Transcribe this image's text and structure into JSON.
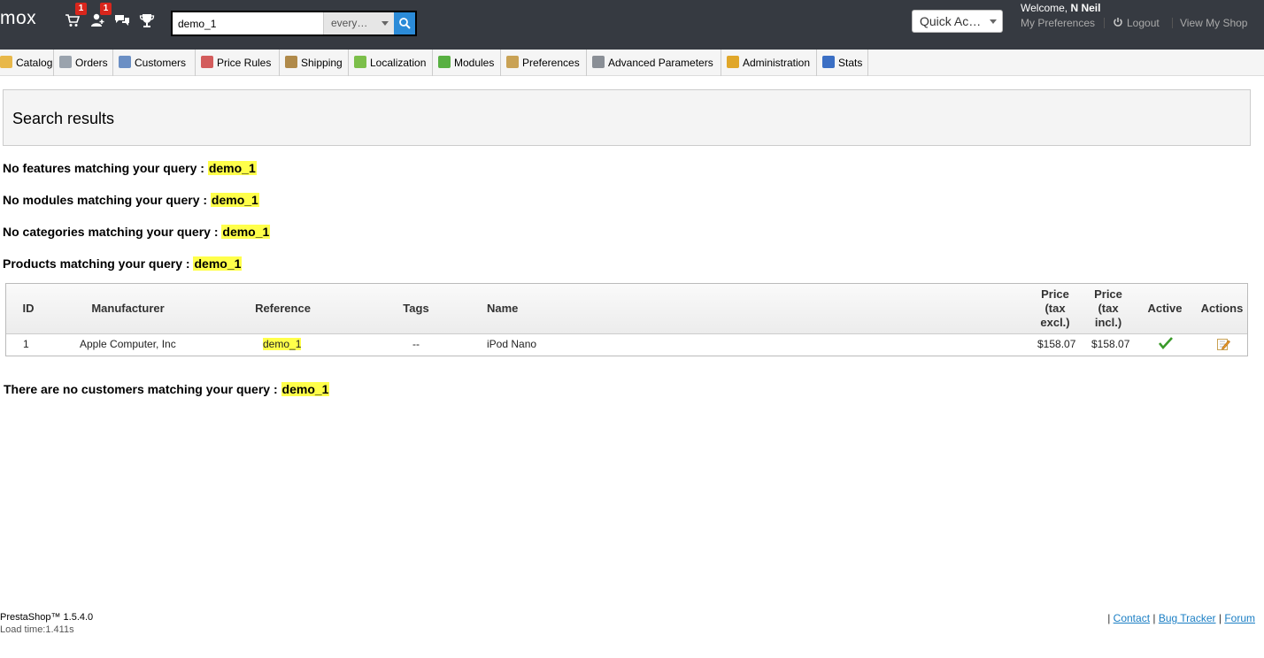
{
  "header": {
    "shop_name": "mox",
    "notifications": {
      "orders_badge": "1",
      "customers_badge": "1"
    },
    "search": {
      "value": "demo_1",
      "scope": "every…"
    },
    "quick_access": "Quick Ac…",
    "welcome_prefix": "Welcome, ",
    "user_name": "N Neil",
    "my_preferences": "My Preferences",
    "logout": "Logout",
    "view_shop": "View My Shop"
  },
  "menu": {
    "items": [
      {
        "label": "Catalog",
        "icon": "folder-icon",
        "color": "#e8b84a"
      },
      {
        "label": "Orders",
        "icon": "cart-icon",
        "color": "#9aa3ad"
      },
      {
        "label": "Customers",
        "icon": "user-icon",
        "color": "#6b8fc4"
      },
      {
        "label": "Price Rules",
        "icon": "tag-icon",
        "color": "#d35c5c"
      },
      {
        "label": "Shipping",
        "icon": "truck-icon",
        "color": "#b08a4a"
      },
      {
        "label": "Localization",
        "icon": "globe-icon",
        "color": "#7cbf4a"
      },
      {
        "label": "Modules",
        "icon": "puzzle-icon",
        "color": "#58b042"
      },
      {
        "label": "Preferences",
        "icon": "settings-icon",
        "color": "#c9a255"
      },
      {
        "label": "Advanced Parameters",
        "icon": "wrench-icon",
        "color": "#8a8f96"
      },
      {
        "label": "Administration",
        "icon": "key-icon",
        "color": "#e0a72a"
      },
      {
        "label": "Stats",
        "icon": "chart-icon",
        "color": "#3b6fc4"
      }
    ]
  },
  "page": {
    "title": "Search results",
    "query": "demo_1",
    "no_features": "No features matching your query : ",
    "no_modules": "No modules matching your query : ",
    "no_categories": "No categories matching your query : ",
    "products": "Products matching your query : ",
    "no_customers": "There are no customers matching your query : "
  },
  "table": {
    "headers": {
      "id": "ID",
      "manufacturer": "Manufacturer",
      "reference": "Reference",
      "tags": "Tags",
      "name": "Name",
      "price_excl": [
        "Price",
        "(tax",
        "excl.)"
      ],
      "price_incl": [
        "Price",
        "(tax",
        "incl.)"
      ],
      "active": "Active",
      "actions": "Actions"
    },
    "rows": [
      {
        "id": "1",
        "manufacturer": "Apple Computer, Inc",
        "reference": "demo_1",
        "tags": "--",
        "name": "iPod Nano",
        "price_excl": "$158.07",
        "price_incl": "$158.07",
        "active": true
      }
    ]
  },
  "footer": {
    "version": "PrestaShop™ 1.5.4.0",
    "load_time": "Load time:1.411s",
    "links": [
      "Contact",
      "Bug Tracker",
      "Forum"
    ]
  }
}
